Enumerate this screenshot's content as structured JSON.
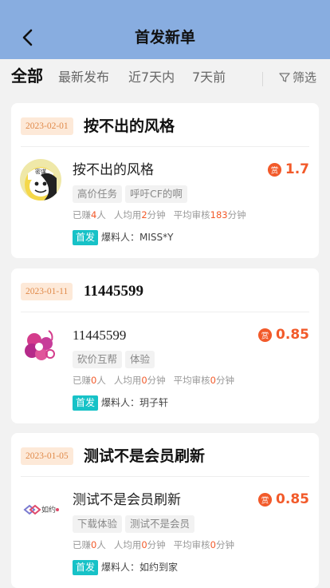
{
  "header": {
    "title": "首发新单"
  },
  "tabs": [
    {
      "label": "全部",
      "active": true
    },
    {
      "label": "最新发布",
      "active": false
    },
    {
      "label": "近7天内",
      "active": false
    },
    {
      "label": "7天前",
      "active": false
    }
  ],
  "filter_label": "筛选",
  "colors": {
    "header_bg": "#88ade0",
    "tab_underline": "#f7c23b",
    "reward": "#f25a2a",
    "badge": "#17c2c7",
    "date_badge_bg": "#fde9d8"
  },
  "cards": [
    {
      "date": "2023-02-01",
      "title": "按不出的风格",
      "task_name": "按不出的风格",
      "reward": "1.7",
      "tags": [
        "高价任务",
        "呼吁CF的啊"
      ],
      "stats": {
        "earned_prefix": "已赚",
        "earned": "4",
        "earned_suffix": "人",
        "avg_prefix": "人均用",
        "avg": "2",
        "avg_suffix": "分钟",
        "review_prefix": "平均审核",
        "review": "183",
        "review_suffix": "分钟"
      },
      "badge": "首发",
      "poster": "爆料人：MISS*Y",
      "avatar": "cartoon-face-avatar"
    },
    {
      "date": "2023-01-11",
      "title": "11445599",
      "task_name": "11445599",
      "reward": "0.85",
      "tags": [
        "砍价互帮",
        "体验"
      ],
      "stats": {
        "earned_prefix": "已赚",
        "earned": "0",
        "earned_suffix": "人",
        "avg_prefix": "人均用",
        "avg": "0",
        "avg_suffix": "分钟",
        "review_prefix": "平均审核",
        "review": "0",
        "review_suffix": "分钟"
      },
      "badge": "首发",
      "poster": "爆料人：玥子轩",
      "avatar": "pink-flower-logo"
    },
    {
      "date": "2023-01-05",
      "title": "测试不是会员刷新",
      "task_name": "测试不是会员刷新",
      "reward": "0.85",
      "tags": [
        "下载体验",
        "测试不是会员"
      ],
      "stats": {
        "earned_prefix": "已赚",
        "earned": "0",
        "earned_suffix": "人",
        "avg_prefix": "人均用",
        "avg": "0",
        "avg_suffix": "分钟",
        "review_prefix": "平均审核",
        "review": "0",
        "review_suffix": "分钟"
      },
      "badge": "首发",
      "poster": "爆料人：如约到家",
      "avatar": "ruyue-logo"
    }
  ]
}
